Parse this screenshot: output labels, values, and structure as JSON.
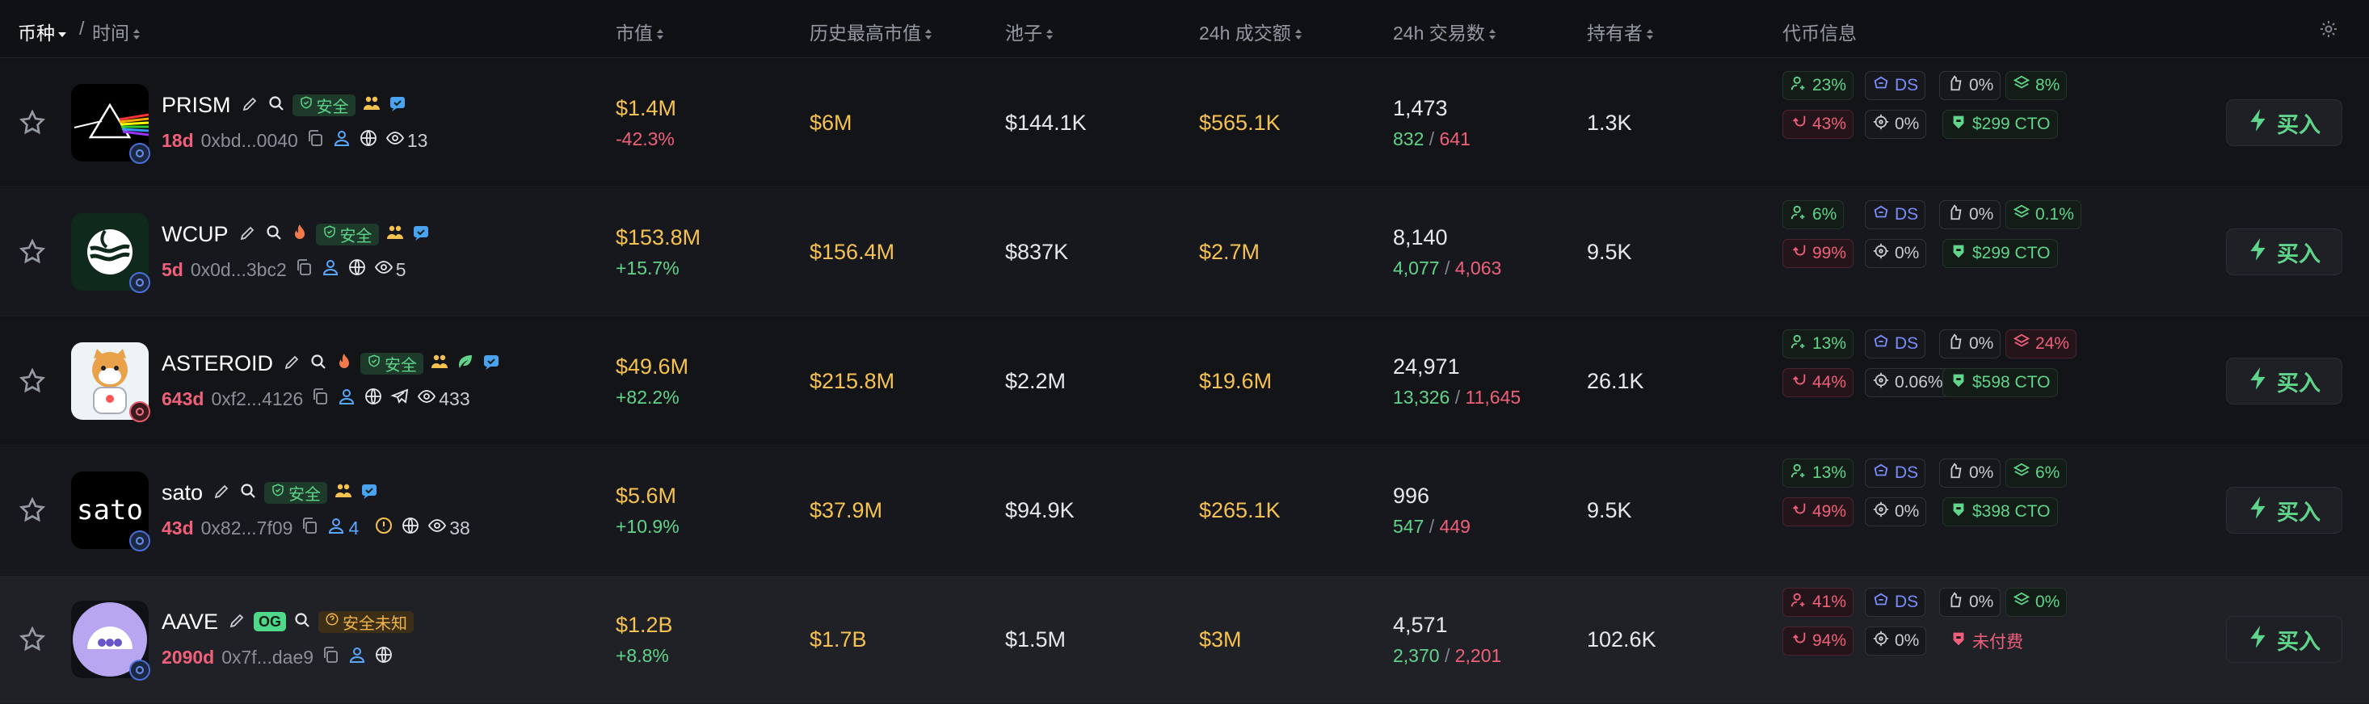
{
  "header": {
    "coin": "币种",
    "sep": "/",
    "time": "时间",
    "market_cap": "市值",
    "ath_market_cap": "历史最高市值",
    "pool": "池子",
    "volume_24h": "24h 成交额",
    "txs_24h": "24h 交易数",
    "holders": "持有者",
    "token_info": "代币信息"
  },
  "buy_label": "买入",
  "safe_label": "安全",
  "unknown_label": "安全未知",
  "og_label": "OG",
  "rows": [
    {
      "symbol": "PRISM",
      "age": "18d",
      "address": "0xbd...0040",
      "watchers": "13",
      "market_cap": "$1.4M",
      "mc_change": "-42.3%",
      "ath": "$6M",
      "pool": "$144.1K",
      "volume": "$565.1K",
      "txs": "1,473",
      "buys": "832",
      "sells": "641",
      "holders": "1.3K",
      "info": {
        "top10": "23%",
        "ds": "DS",
        "dev": "0%",
        "snipers": "8%",
        "insiders": "43%",
        "bundle": "0%",
        "cto": "$299 CTO"
      }
    },
    {
      "symbol": "WCUP",
      "age": "5d",
      "address": "0x0d...3bc2",
      "watchers": "5",
      "market_cap": "$153.8M",
      "mc_change": "+15.7%",
      "ath": "$156.4M",
      "pool": "$837K",
      "volume": "$2.7M",
      "txs": "8,140",
      "buys": "4,077",
      "sells": "4,063",
      "holders": "9.5K",
      "info": {
        "top10": "6%",
        "ds": "DS",
        "dev": "0%",
        "snipers": "0.1%",
        "insiders": "99%",
        "bundle": "0%",
        "cto": "$299 CTO"
      }
    },
    {
      "symbol": "ASTEROID",
      "age": "643d",
      "address": "0xf2...4126",
      "watchers": "433",
      "market_cap": "$49.6M",
      "mc_change": "+82.2%",
      "ath": "$215.8M",
      "pool": "$2.2M",
      "volume": "$19.6M",
      "txs": "24,971",
      "buys": "13,326",
      "sells": "11,645",
      "holders": "26.1K",
      "info": {
        "top10": "13%",
        "ds": "DS",
        "dev": "0%",
        "snipers": "24%",
        "insiders": "44%",
        "bundle": "0.06%",
        "cto": "$598 CTO"
      }
    },
    {
      "symbol": "sato",
      "age": "43d",
      "address": "0x82...7f09",
      "user_count": "4",
      "watchers": "38",
      "market_cap": "$5.6M",
      "mc_change": "+10.9%",
      "ath": "$37.9M",
      "pool": "$94.9K",
      "volume": "$265.1K",
      "txs": "996",
      "buys": "547",
      "sells": "449",
      "holders": "9.5K",
      "logo_text": "sato",
      "info": {
        "top10": "13%",
        "ds": "DS",
        "dev": "0%",
        "snipers": "6%",
        "insiders": "49%",
        "bundle": "0%",
        "cto": "$398 CTO"
      }
    },
    {
      "symbol": "AAVE",
      "age": "2090d",
      "address": "0x7f...dae9",
      "market_cap": "$1.2B",
      "mc_change": "+8.8%",
      "ath": "$1.7B",
      "pool": "$1.5M",
      "volume": "$3M",
      "txs": "4,571",
      "buys": "2,370",
      "sells": "2,201",
      "holders": "102.6K",
      "info": {
        "top10": "41%",
        "ds": "DS",
        "dev": "0%",
        "snipers": "0%",
        "insiders": "94%",
        "bundle": "0%",
        "cto": "未付费"
      }
    }
  ]
}
